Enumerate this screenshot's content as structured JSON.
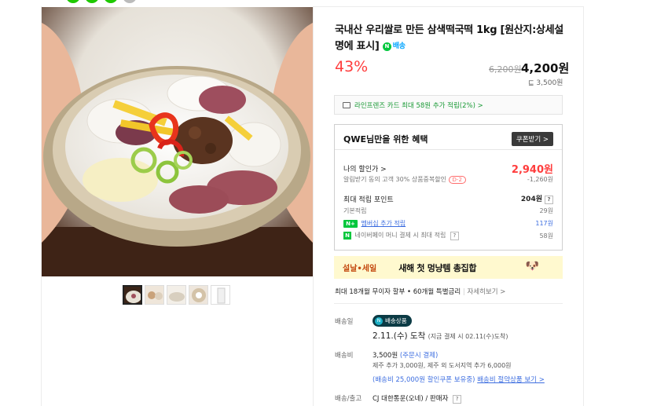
{
  "product": {
    "title": "국내산 우리쌀로 만든 삼색떡국떡 1kg [원산지:상세설명에 표시]",
    "npay_label": "배송",
    "discount": "43%",
    "original_price": "6,200원",
    "sale_price": "4,200원",
    "unit_price": "3,500원"
  },
  "card_promo": "라인프렌즈 카드 최대 58원 추가 적립(2%) >",
  "benefit": {
    "title": "QWE님만을 위한 혜택",
    "coupon_button": "쿠폰받기 >",
    "my_discount_label": "나의 할인가 >",
    "my_discount_value": "2,940원",
    "coupon_detail": "알림받기 동의 고객 30% 상품중복할인",
    "coupon_dday": "D-2",
    "coupon_amount": "-1,260원",
    "max_points_label": "최대 적립 포인트",
    "max_points_value": "204원",
    "basic_label": "기본적립",
    "basic_value": "29원",
    "membership_label": "멤버십 추가 적립",
    "membership_value": "117원",
    "npay_money_label": "네이버페이 머니 결제 시 최대 적립",
    "npay_money_value": "58원"
  },
  "event": {
    "tag": "설날•세일",
    "text": "새해 첫 멍냥템 총집합"
  },
  "installment": {
    "text": "최대 18개월 무이자 할부 • 60개월 특별금리",
    "more": "자세히보기 >"
  },
  "shipping": {
    "label": "배송일",
    "badge": "배송상품",
    "arrive_date": "2.11.(수) 도착",
    "arrive_note": "(지금 결제 시 02.11(수)도착)",
    "fee_label": "배송비",
    "fee": "3,500원",
    "fee_note": "(주문시 결제)",
    "extra_fee": "제주 추가 3,000원, 제주 외 도서지역 추가 6,000원",
    "coupon_note": "(배송비 25,000원 할인쿠폰 보유중)",
    "bundle_link": "배송비 절약상품 보기 >",
    "courier_label": "배송/출고",
    "courier": "CJ 대한통운(오네) / 판매자"
  },
  "colors": {
    "discount": "#ff3d3d",
    "accent_green": "#00c73c",
    "link": "#3d6ee0"
  },
  "icons": [
    "n-pay-icon",
    "card-icon",
    "question-icon",
    "chevron-right-icon",
    "dog-cat-icon"
  ]
}
